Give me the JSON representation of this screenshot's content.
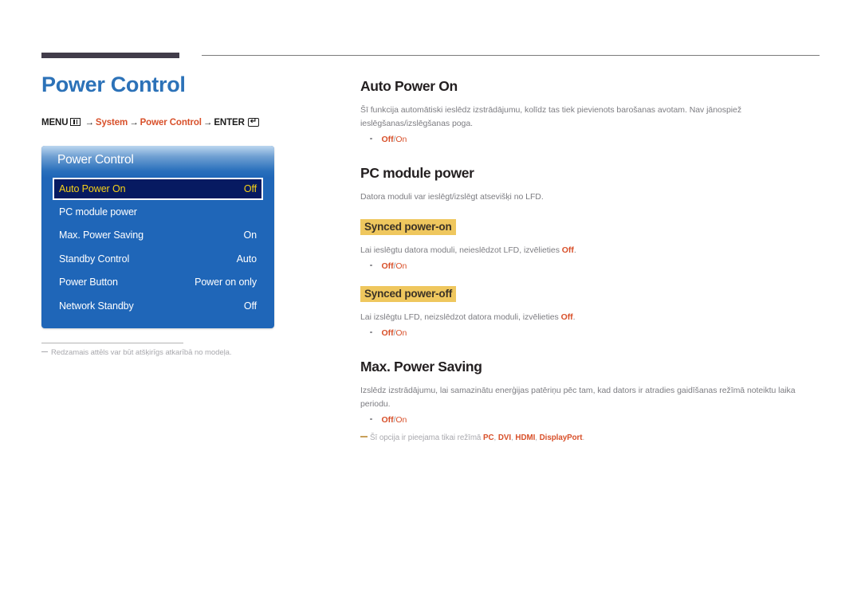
{
  "header": {
    "title": "Power Control",
    "breadcrumb": {
      "menu_label": "MENU",
      "menu_icon": "menu-grid-icon",
      "arrow": "→",
      "step1": "System",
      "step2": "Power Control",
      "enter_label": "ENTER",
      "enter_icon": "enter-key-icon"
    }
  },
  "osd": {
    "title": "Power Control",
    "rows": [
      {
        "label": "Auto Power On",
        "value": "Off",
        "selected": true
      },
      {
        "label": "PC module power",
        "value": "",
        "selected": false
      },
      {
        "label": "Max. Power Saving",
        "value": "On",
        "selected": false
      },
      {
        "label": "Standby Control",
        "value": "Auto",
        "selected": false
      },
      {
        "label": "Power Button",
        "value": "Power on only",
        "selected": false
      },
      {
        "label": "Network Standby",
        "value": "Off",
        "selected": false
      }
    ],
    "footnote": "Redzamais attēls var būt atšķirīgs atkarībā no modeļa."
  },
  "sections": {
    "auto_power_on": {
      "title": "Auto Power On",
      "body": "Šī funkcija automātiski ieslēdz izstrādājumu, kolīdz tas tiek pievienots barošanas avotam. Nav jānospiež ieslēgšanas/izslēgšanas poga.",
      "bullet_off": "Off",
      "bullet_sep": "/",
      "bullet_on": "On"
    },
    "pc_module_power": {
      "title": "PC module power",
      "body": "Datora moduli var ieslēgt/izslēgt atsevišķi no LFD.",
      "synced_on": {
        "heading": "Synced power-on",
        "body_pre": "Lai ieslēgtu datora moduli, neieslēdzot LFD, izvēlieties ",
        "body_hl": "Off",
        "body_post": ".",
        "bullet_off": "Off",
        "bullet_sep": "/",
        "bullet_on": "On"
      },
      "synced_off": {
        "heading": "Synced power-off",
        "body_pre": "Lai izslēgtu LFD, neizslēdzot datora moduli, izvēlieties ",
        "body_hl": "Off",
        "body_post": ".",
        "bullet_off": "Off",
        "bullet_sep": "/",
        "bullet_on": "On"
      }
    },
    "max_power_saving": {
      "title": "Max. Power Saving",
      "body": "Izslēdz izstrādājumu, lai samazinātu enerģijas patēriņu pēc tam, kad dators ir atradies gaidīšanas režīmā noteiktu laika periodu.",
      "bullet_off": "Off",
      "bullet_sep": "/",
      "bullet_on": "On",
      "note_pre": "Šī opcija ir pieejama tikai režīmā ",
      "note_modes": [
        "PC",
        "DVI",
        "HDMI",
        "DisplayPort"
      ],
      "note_post": "."
    }
  },
  "colors": {
    "title_blue": "#2c72b8",
    "accent_orange": "#d8502a",
    "osd_blue": "#1f66b8",
    "osd_selected_bg": "#071a61",
    "osd_selected_text": "#f7d117",
    "subhead_highlight": "#efc75e"
  }
}
